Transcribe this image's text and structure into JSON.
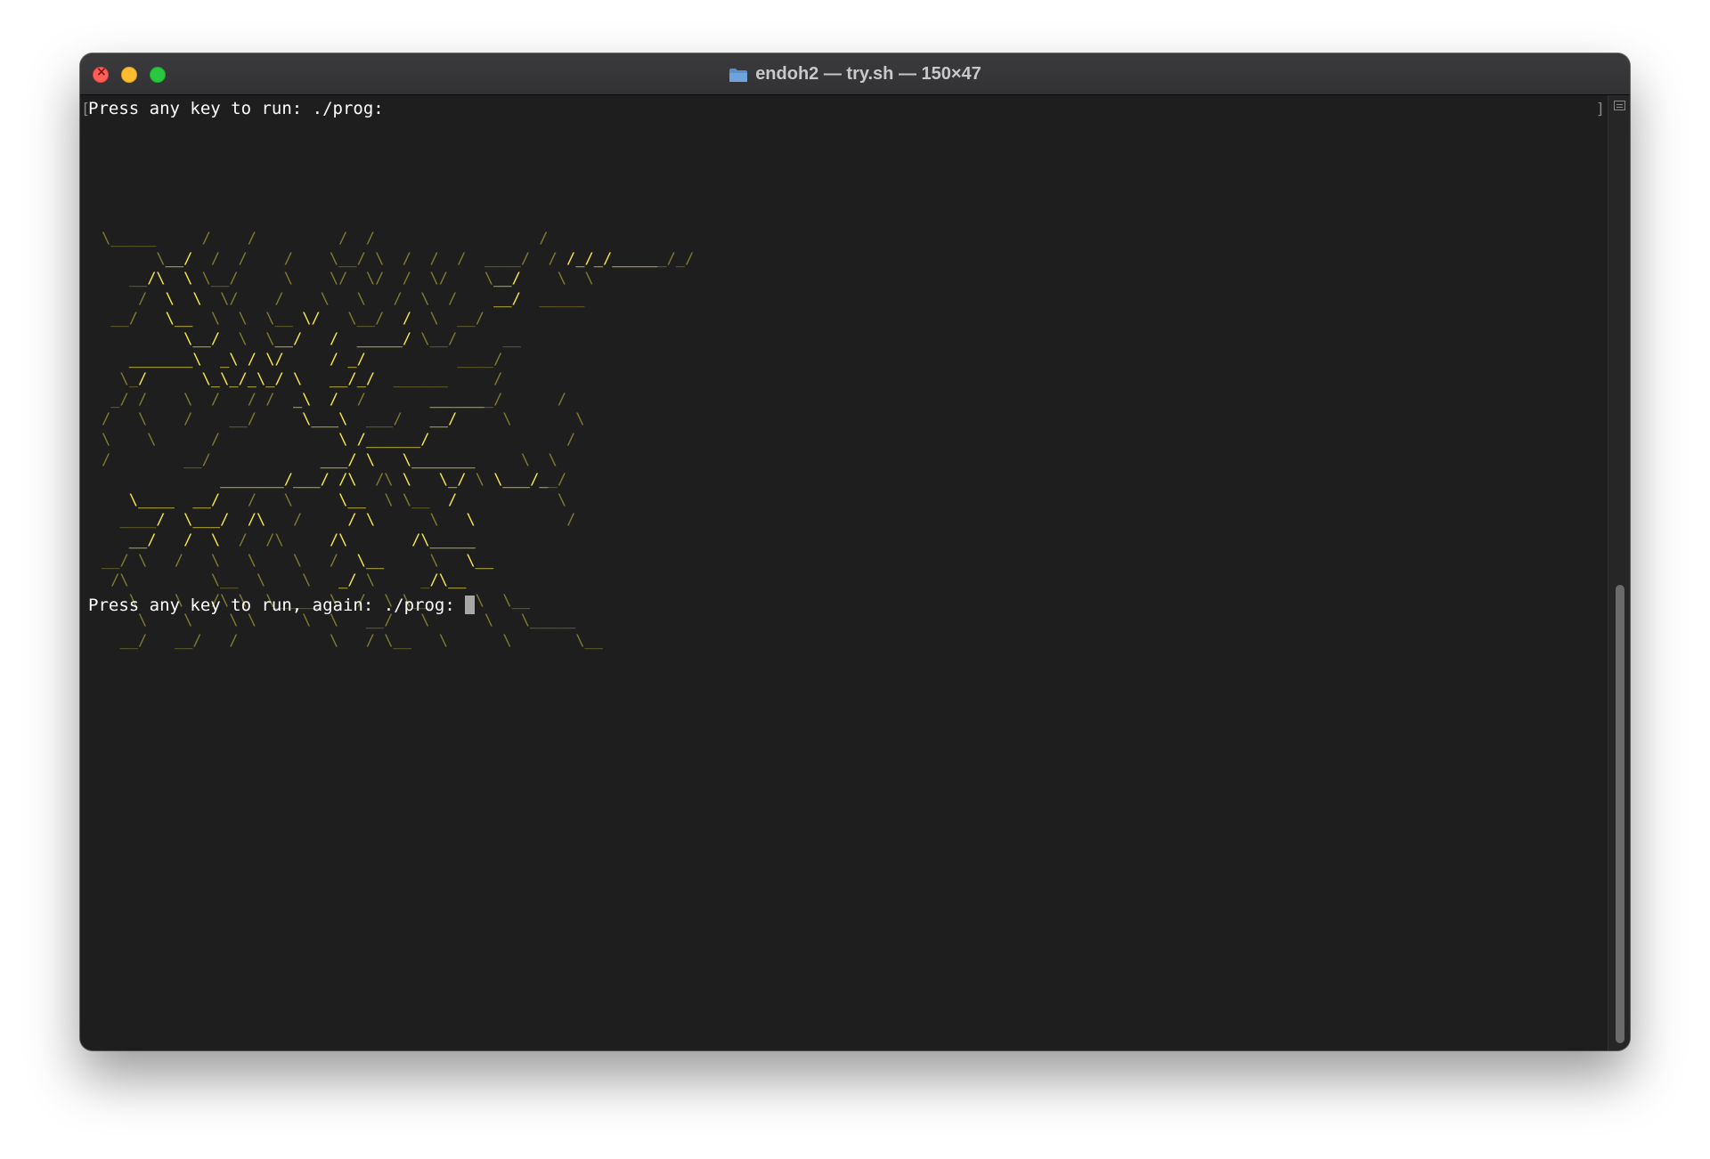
{
  "window": {
    "title": "endoh2 — try.sh — 150×47"
  },
  "terminal": {
    "line1": "Press any key to run: ./prog:",
    "line2": "Press any key to run, again: ./prog: "
  },
  "icons": {
    "title_icon": "folder-icon",
    "scroll_corner": "scroll-marks-icon"
  },
  "colors": {
    "background": "#1e1e1e",
    "text": "#ffffff",
    "ascii_art": "#c9c23f",
    "close": "#fe5f57",
    "minimize": "#febc2e",
    "maximize": "#28c840"
  }
}
